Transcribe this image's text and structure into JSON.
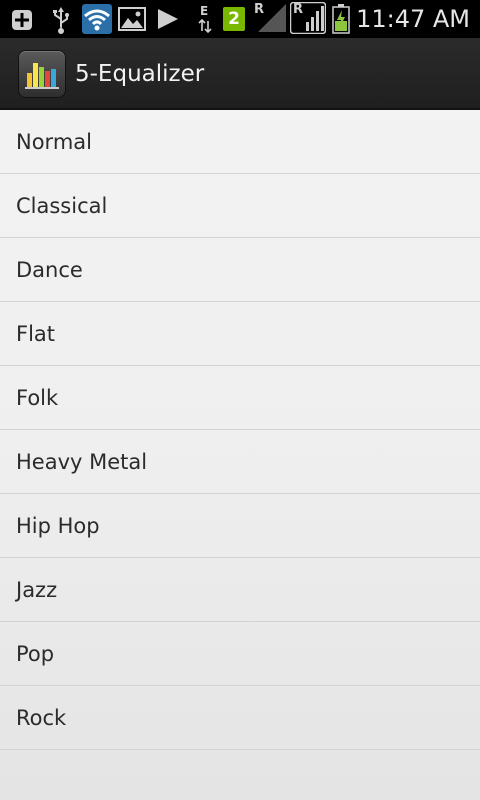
{
  "status_bar": {
    "time": "11:47 AM",
    "network_type": "E",
    "sim_slot": "2",
    "roaming_indicator_1": "R",
    "roaming_indicator_2": "R",
    "icons": [
      "add-icon",
      "usb-icon",
      "wifi-icon",
      "gallery-icon",
      "play-icon",
      "data-arrows-icon",
      "sim-badge-icon",
      "signal-icon",
      "signal-icon",
      "battery-charging-icon"
    ],
    "colors": {
      "background": "#000000",
      "sim_badge": "#7ab800",
      "battery_fill": "#8dc63f"
    }
  },
  "action_bar": {
    "title": "5-Equalizer",
    "icon": "equalizer-app-icon"
  },
  "presets": [
    {
      "label": "Normal"
    },
    {
      "label": "Classical"
    },
    {
      "label": "Dance"
    },
    {
      "label": "Flat"
    },
    {
      "label": "Folk"
    },
    {
      "label": "Heavy Metal"
    },
    {
      "label": "Hip Hop"
    },
    {
      "label": "Jazz"
    },
    {
      "label": "Pop"
    },
    {
      "label": "Rock"
    }
  ]
}
